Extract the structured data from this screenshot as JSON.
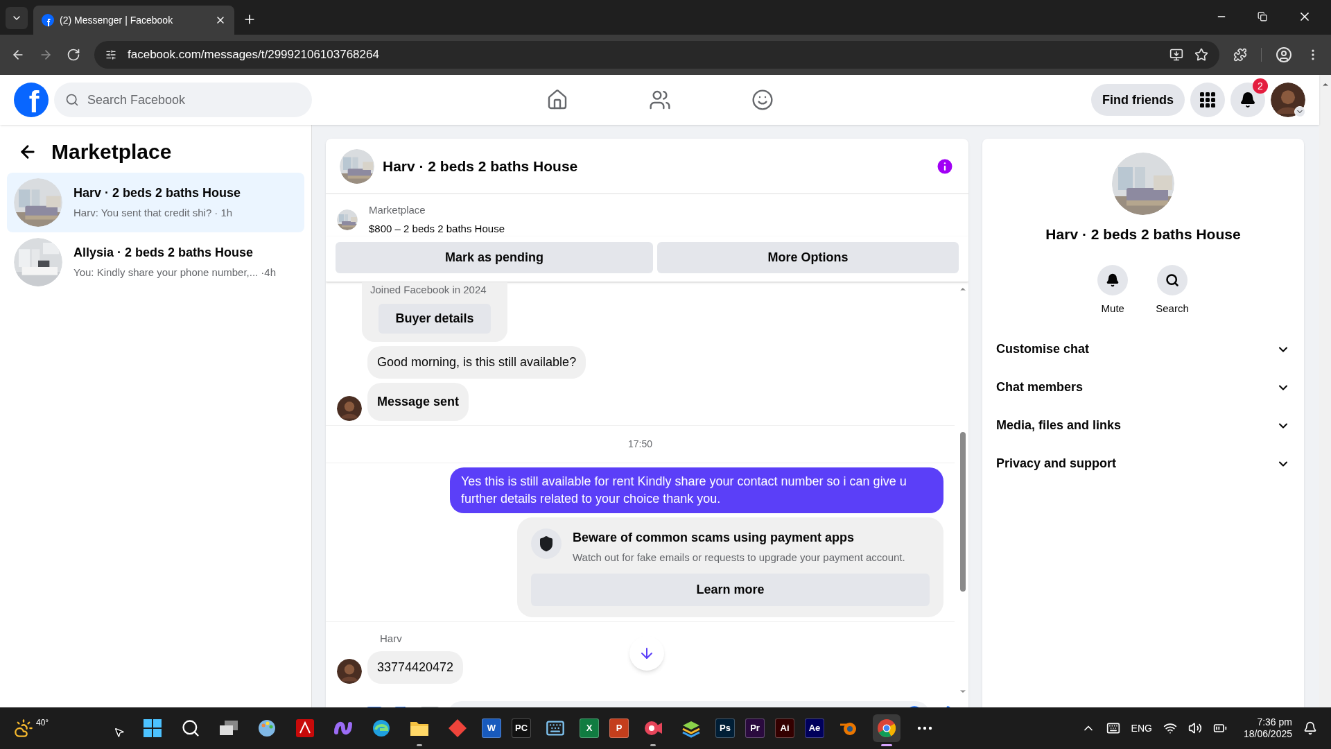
{
  "browser": {
    "tab_title": "(2) Messenger | Facebook",
    "url": "facebook.com/messages/t/29992106103768264"
  },
  "header": {
    "logo": "f",
    "search_placeholder": "Search Facebook",
    "nav": [
      {
        "kind": "home",
        "selected": false
      },
      {
        "kind": "friends",
        "selected": false
      },
      {
        "kind": "groups",
        "selected": false
      }
    ],
    "find_friends": "Find friends",
    "notifications_badge": "2"
  },
  "sidebar": {
    "title": "Marketplace",
    "conversations": [
      {
        "title": "Harv · 2 beds 2 baths House",
        "preview": "Harv: You sent that credit shi?",
        "time": "· 1h",
        "selected": true
      },
      {
        "title": "Allysia · 2 beds 2 baths House",
        "preview": "You: Kindly share your phone number,...",
        "time": "·4h",
        "selected": false
      }
    ]
  },
  "chat": {
    "title": "Harv · 2 beds 2 baths House",
    "listing": {
      "source": "Marketplace",
      "summary": "$800 – 2 beds 2 baths House"
    },
    "actions": [
      "Mark as pending",
      "More Options"
    ],
    "messages": [
      {
        "kind": "buyer_card",
        "text": "Joined Facebook in 2024",
        "button": "Buyer details"
      },
      {
        "kind": "incoming",
        "text": "Good morning, is this still available?",
        "avatar": false
      },
      {
        "kind": "incoming_bold",
        "text": "Message sent",
        "avatar": true
      },
      {
        "kind": "timestamp",
        "text": "17:50"
      },
      {
        "kind": "outgoing",
        "text": "Yes this is still available for rent Kindly share your contact number so i can give u further details related to your choice thank you."
      },
      {
        "kind": "notice",
        "title": "Beware of common scams using payment apps",
        "body": "Watch out for fake emails or requests to upgrade your payment account.",
        "button": "Learn more"
      },
      {
        "kind": "sender",
        "text": "Harv"
      },
      {
        "kind": "incoming",
        "text": "33774420472",
        "avatar": true
      }
    ]
  },
  "details": {
    "title": "Harv · 2 beds 2 baths House",
    "actions": [
      {
        "kind": "mute",
        "label": "Mute"
      },
      {
        "kind": "search",
        "label": "Search"
      }
    ],
    "sections": [
      {
        "label": "Customise chat",
        "expanded": false
      },
      {
        "label": "Chat members",
        "expanded": false
      },
      {
        "label": "Media, files and links",
        "expanded": false
      },
      {
        "label": "Privacy and support",
        "expanded": false
      }
    ]
  },
  "taskbar": {
    "weather": "40°",
    "apps": [
      {
        "kind": "start"
      },
      {
        "kind": "search"
      },
      {
        "kind": "taskview"
      },
      {
        "kind": "palette"
      },
      {
        "kind": "pdf"
      },
      {
        "kind": "copilot"
      },
      {
        "kind": "browser"
      },
      {
        "kind": "folder",
        "running": true
      },
      {
        "kind": "diamond"
      },
      {
        "kind": "tile",
        "label": "W",
        "color": "#185abd"
      },
      {
        "kind": "tile",
        "label": "PC",
        "color": "#111111"
      },
      {
        "kind": "keyboard"
      },
      {
        "kind": "tile",
        "label": "X",
        "color": "#107c41"
      },
      {
        "kind": "tile",
        "label": "P",
        "color": "#c43e1c"
      },
      {
        "kind": "camera",
        "running": true
      },
      {
        "kind": "stack"
      },
      {
        "kind": "tile",
        "label": "Ps",
        "color": "#001e36"
      },
      {
        "kind": "tile",
        "label": "Pr",
        "color": "#2a0a3e"
      },
      {
        "kind": "tile",
        "label": "Ai",
        "color": "#330000"
      },
      {
        "kind": "tile",
        "label": "Ae",
        "color": "#00005b"
      },
      {
        "kind": "blender"
      },
      {
        "kind": "chrome",
        "running": true,
        "selected": true
      },
      {
        "kind": "more"
      }
    ],
    "language": "ENG",
    "time": "7:36 pm",
    "date": "18/06/2025"
  }
}
